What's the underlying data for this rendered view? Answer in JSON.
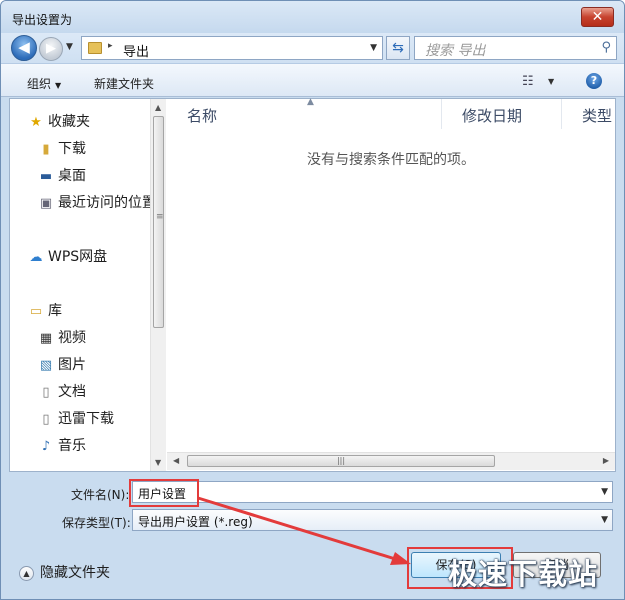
{
  "window": {
    "title": "导出设置为",
    "close_glyph": "✕"
  },
  "address": {
    "back_glyph": "◀",
    "forward_glyph": "▶",
    "path_separator": "▸",
    "path": "导出",
    "refresh_glyph": "⇆",
    "search_placeholder": "搜索 导出"
  },
  "toolbar": {
    "organize": "组织",
    "new_folder": "新建文件夹",
    "help_glyph": "?"
  },
  "nav": {
    "favorites": "收藏夹",
    "downloads": "下载",
    "desktop": "桌面",
    "recent": "最近访问的位置",
    "wps_cloud": "WPS网盘",
    "libraries": "库",
    "videos": "视频",
    "pictures": "图片",
    "documents": "文档",
    "thunder_downloads": "迅雷下载",
    "music": "音乐"
  },
  "columns": {
    "name": "名称",
    "modified": "修改日期",
    "type": "类型"
  },
  "empty_message": "没有与搜索条件匹配的项。",
  "form": {
    "filename_label": "文件名(N):",
    "filename_value": "用户设置",
    "filetype_label": "保存类型(T):",
    "filetype_value": "导出用户设置 (*.reg)"
  },
  "buttons": {
    "hide_folders": "隐藏文件夹",
    "save": "保存(S)",
    "cancel": "取消"
  },
  "watermark": "极速下载站",
  "colors": {
    "highlight": "#e33b3b",
    "window_frame": "#c9dcef",
    "accent_blue": "#2d6cb9"
  }
}
